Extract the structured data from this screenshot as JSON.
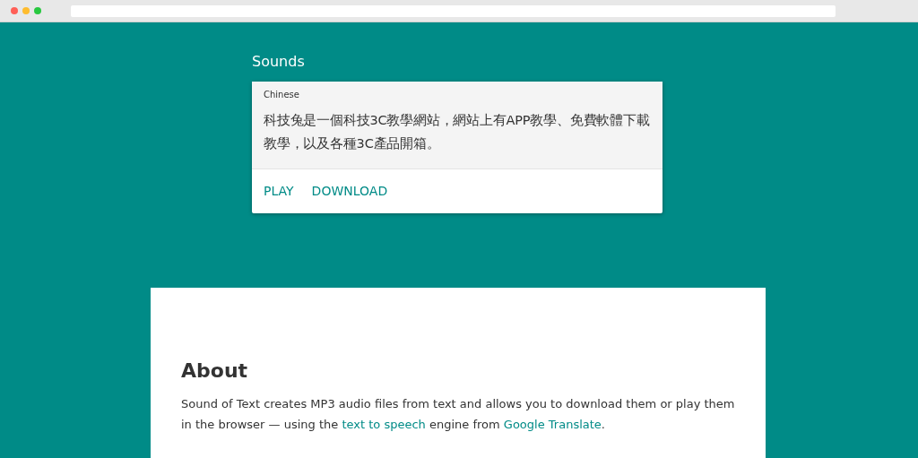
{
  "sounds": {
    "title": "Sounds",
    "card": {
      "language": "Chinese",
      "text": "科技兔是一個科技3C教學網站，網站上有APP教學、免費軟體下載教學，以及各種3C產品開箱。",
      "actions": [
        "PLAY",
        "DOWNLOAD"
      ]
    }
  },
  "about": {
    "heading": "About",
    "paragraphs": [
      [
        {
          "kind": "text",
          "text": "Sound of Text creates MP3 audio files from text and allows you to download them or play them in the browser — using the "
        },
        {
          "kind": "link",
          "text": "text to speech"
        },
        {
          "kind": "text",
          "text": " engine from "
        },
        {
          "kind": "link",
          "text": "Google Translate"
        },
        {
          "kind": "text",
          "text": "."
        }
      ]
    ]
  }
}
